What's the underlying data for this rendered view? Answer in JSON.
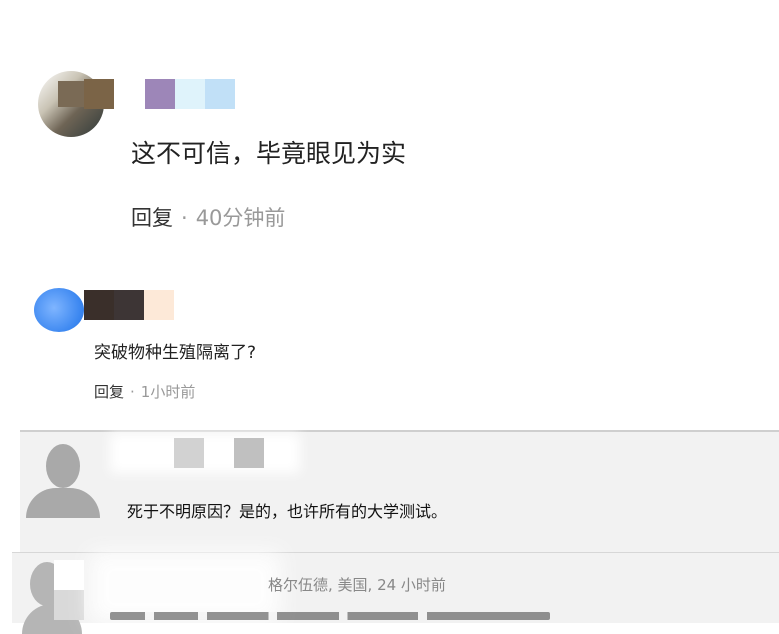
{
  "comment1": {
    "text": "这不可信，毕竟眼见为实",
    "reply_label": "回复",
    "separator": "·",
    "time": "40分钟前"
  },
  "comment2": {
    "text": "突破物种生殖隔离了?",
    "reply_label": "回复",
    "separator": "·",
    "time": "1小时前"
  },
  "comment3": {
    "text": "死于不明原因？是的，也许所有的大学测试。"
  },
  "comment4": {
    "meta": "格尔伍德, 美国, 24 小时前"
  }
}
